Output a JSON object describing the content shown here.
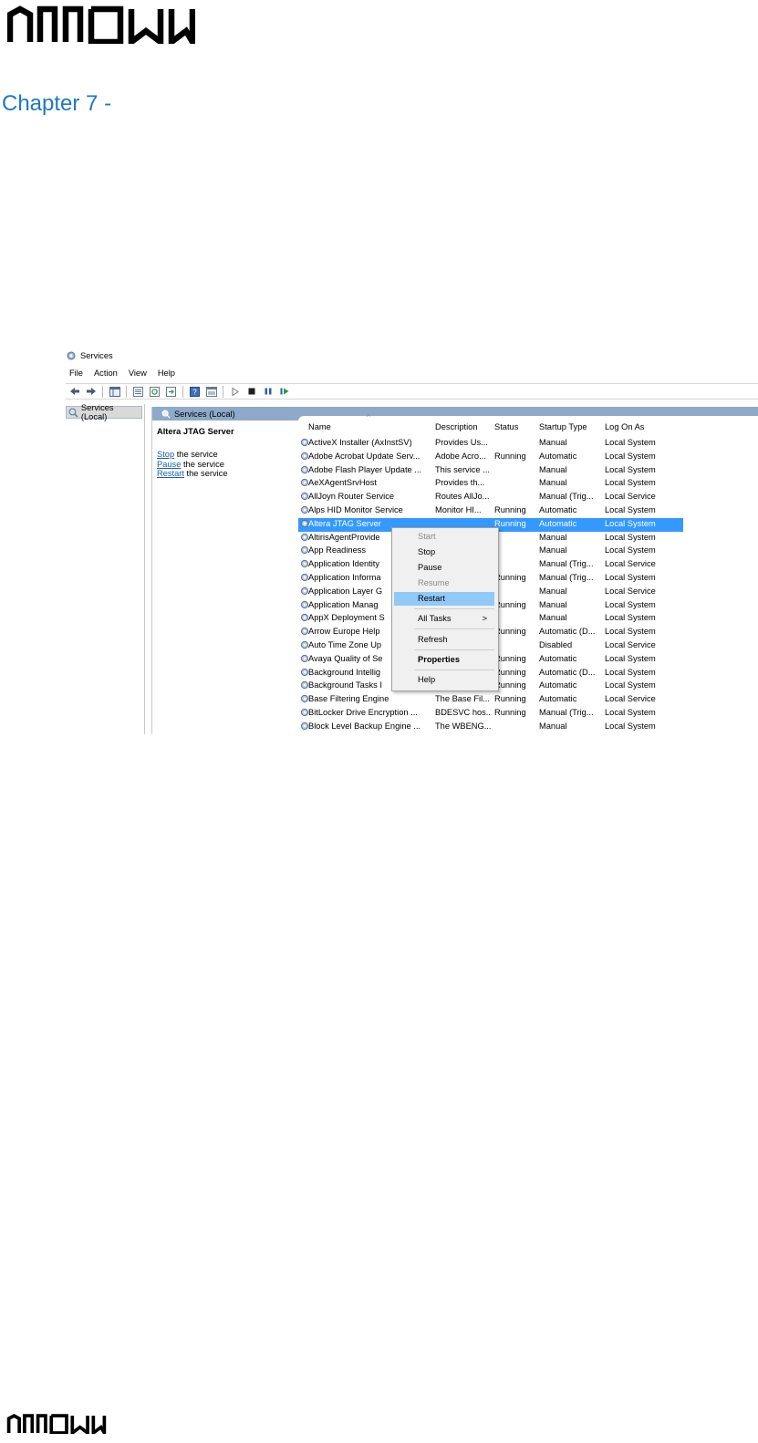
{
  "heading": "Chapter 7 -",
  "logo": {
    "text": "ARROW"
  },
  "window": {
    "title": "Services",
    "menu": [
      "File",
      "Action",
      "View",
      "Help"
    ],
    "tree_item": "Services (Local)",
    "panel_header": "Services (Local)",
    "selected_service": "Altera JTAG Server",
    "actions": [
      {
        "link": "Stop",
        "text": " the service"
      },
      {
        "link": "Pause",
        "text": " the service"
      },
      {
        "link": "Restart",
        "text": " the service"
      }
    ],
    "columns": [
      "Name",
      "Description",
      "Status",
      "Startup Type",
      "Log On As"
    ],
    "rows": [
      {
        "name": "ActiveX Installer (AxInstSV)",
        "description": "Provides Us...",
        "status": "",
        "startup": "Manual",
        "logon": "Local System"
      },
      {
        "name": "Adobe Acrobat Update Serv...",
        "description": "Adobe Acro...",
        "status": "Running",
        "startup": "Automatic",
        "logon": "Local System"
      },
      {
        "name": "Adobe Flash Player Update ...",
        "description": "This service ...",
        "status": "",
        "startup": "Manual",
        "logon": "Local System"
      },
      {
        "name": "AeXAgentSrvHost",
        "description": "Provides th...",
        "status": "",
        "startup": "Manual",
        "logon": "Local System"
      },
      {
        "name": "AllJoyn Router Service",
        "description": "Routes AllJo...",
        "status": "",
        "startup": "Manual (Trig...",
        "logon": "Local Service"
      },
      {
        "name": "Alps HID Monitor Service",
        "description": "Monitor HI...",
        "status": "Running",
        "startup": "Automatic",
        "logon": "Local System"
      },
      {
        "name": "Altera JTAG Server",
        "description": "",
        "status": "Running",
        "startup": "Automatic",
        "logon": "Local System"
      },
      {
        "name": "AltirisAgentProvide",
        "description": "",
        "status": "",
        "startup": "Manual",
        "logon": "Local System"
      },
      {
        "name": "App Readiness",
        "description": "",
        "status": "",
        "startup": "Manual",
        "logon": "Local System"
      },
      {
        "name": "Application Identity",
        "description": "",
        "status": "",
        "startup": "Manual (Trig...",
        "logon": "Local Service"
      },
      {
        "name": "Application Informa",
        "description": "",
        "status": "Running",
        "startup": "Manual (Trig...",
        "logon": "Local System"
      },
      {
        "name": "Application Layer G",
        "description": "",
        "status": "",
        "startup": "Manual",
        "logon": "Local Service"
      },
      {
        "name": "Application Manag",
        "description": "",
        "status": "Running",
        "startup": "Manual",
        "logon": "Local System"
      },
      {
        "name": "AppX Deployment S",
        "description": "",
        "status": "",
        "startup": "Manual",
        "logon": "Local System"
      },
      {
        "name": "Arrow Europe Help",
        "description": "",
        "status": "Running",
        "startup": "Automatic (D...",
        "logon": "Local System"
      },
      {
        "name": "Auto Time Zone Up",
        "description": "",
        "status": "",
        "startup": "Disabled",
        "logon": "Local Service"
      },
      {
        "name": "Avaya Quality of Se",
        "description": "",
        "status": "Running",
        "startup": "Automatic",
        "logon": "Local System"
      },
      {
        "name": "Background Intellig",
        "description": "",
        "status": "Running",
        "startup": "Automatic (D...",
        "logon": "Local System"
      },
      {
        "name": "Background Tasks I",
        "description": "",
        "status": "Running",
        "startup": "Automatic",
        "logon": "Local System"
      },
      {
        "name": "Base Filtering Engine",
        "description": "The Base Fil...",
        "status": "Running",
        "startup": "Automatic",
        "logon": "Local Service"
      },
      {
        "name": "BitLocker Drive Encryption ...",
        "description": "BDESVC hos...",
        "status": "Running",
        "startup": "Manual (Trig...",
        "logon": "Local System"
      },
      {
        "name": "Block Level Backup Engine ...",
        "description": "The WBENG...",
        "status": "",
        "startup": "Manual",
        "logon": "Local System"
      }
    ],
    "context_menu": {
      "start": "Start",
      "stop": "Stop",
      "pause": "Pause",
      "resume": "Resume",
      "restart": "Restart",
      "all_tasks": "All Tasks",
      "all_tasks_arrow": ">",
      "refresh": "Refresh",
      "properties": "Properties",
      "help": "Help"
    }
  }
}
